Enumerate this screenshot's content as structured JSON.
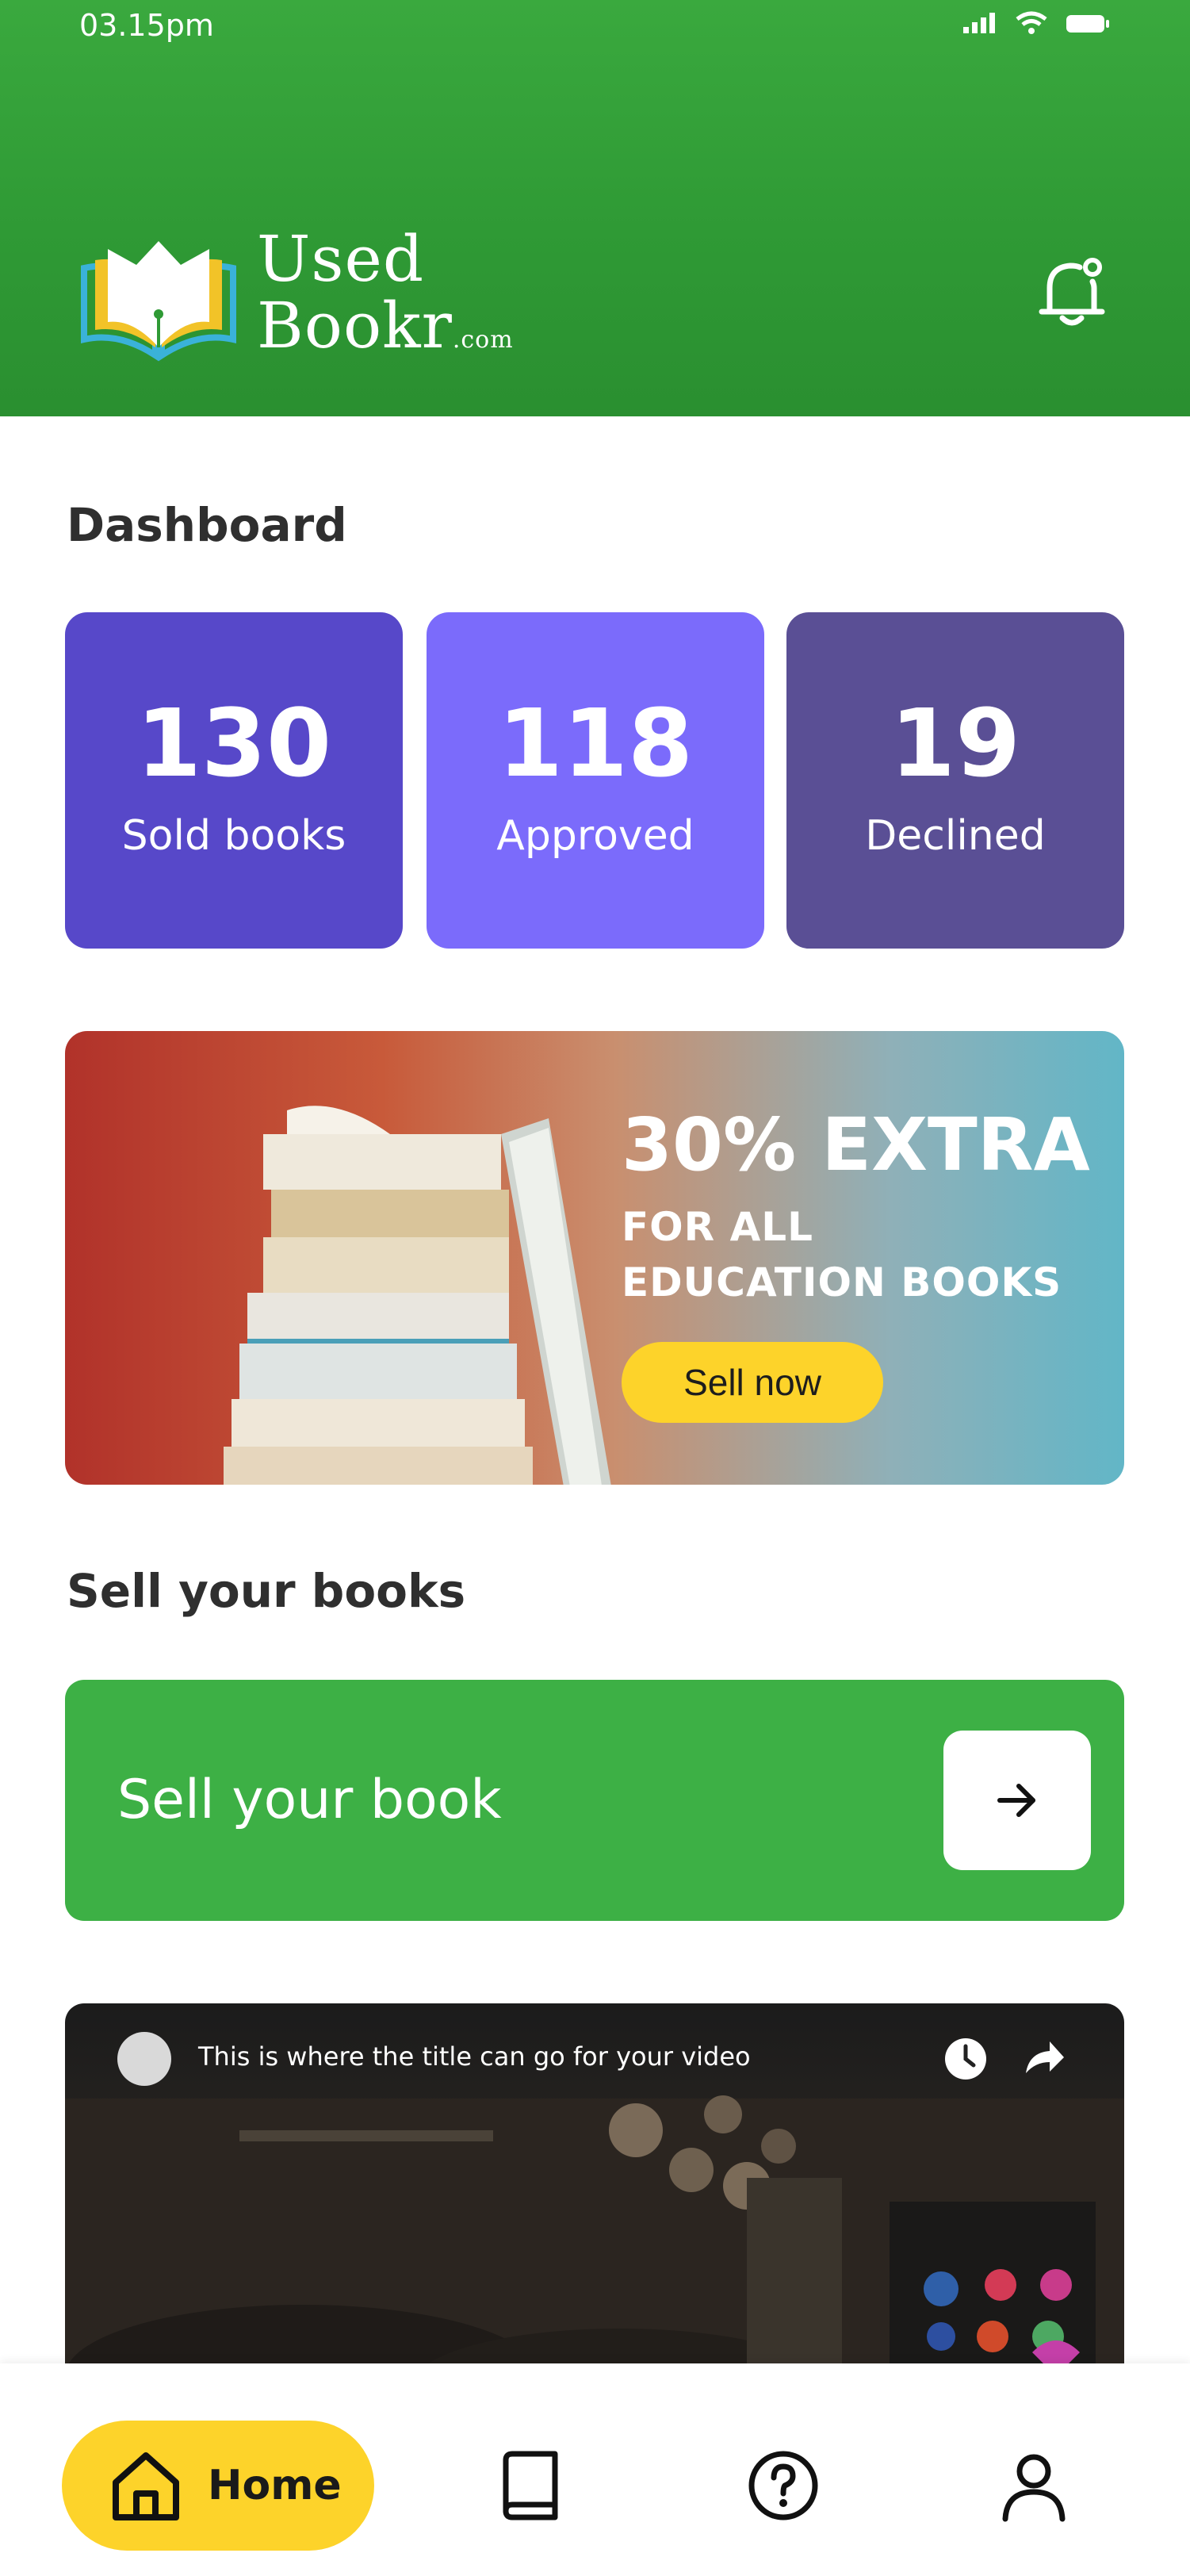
{
  "status_bar": {
    "time": "03.15pm"
  },
  "header": {
    "logo_line1": "Used",
    "logo_line2": "Bookr",
    "logo_suffix": ".com",
    "bell_icon": "bell-icon"
  },
  "dashboard": {
    "title": "Dashboard",
    "stats": [
      {
        "value": "130",
        "label": "Sold books",
        "color": "#5748c9"
      },
      {
        "value": "118",
        "label": "Approved",
        "color": "#7b6bfb"
      },
      {
        "value": "19",
        "label": "Declined",
        "color": "#5a4f95"
      }
    ]
  },
  "promo": {
    "headline": "30% EXTRA",
    "subtext": "FOR ALL EDUCATION BOOKS",
    "button_label": "Sell now"
  },
  "sell": {
    "section_title": "Sell your books",
    "card_label": "Sell your book",
    "arrow_icon": "arrow-right-icon"
  },
  "video": {
    "title": "This is where the title can go for your video"
  },
  "bottom_nav": {
    "home_label": "Home",
    "items": [
      "home-icon",
      "book-icon",
      "help-icon",
      "profile-icon"
    ]
  },
  "colors": {
    "brand_green": "#3db045",
    "accent_yellow": "#fdd32a"
  }
}
